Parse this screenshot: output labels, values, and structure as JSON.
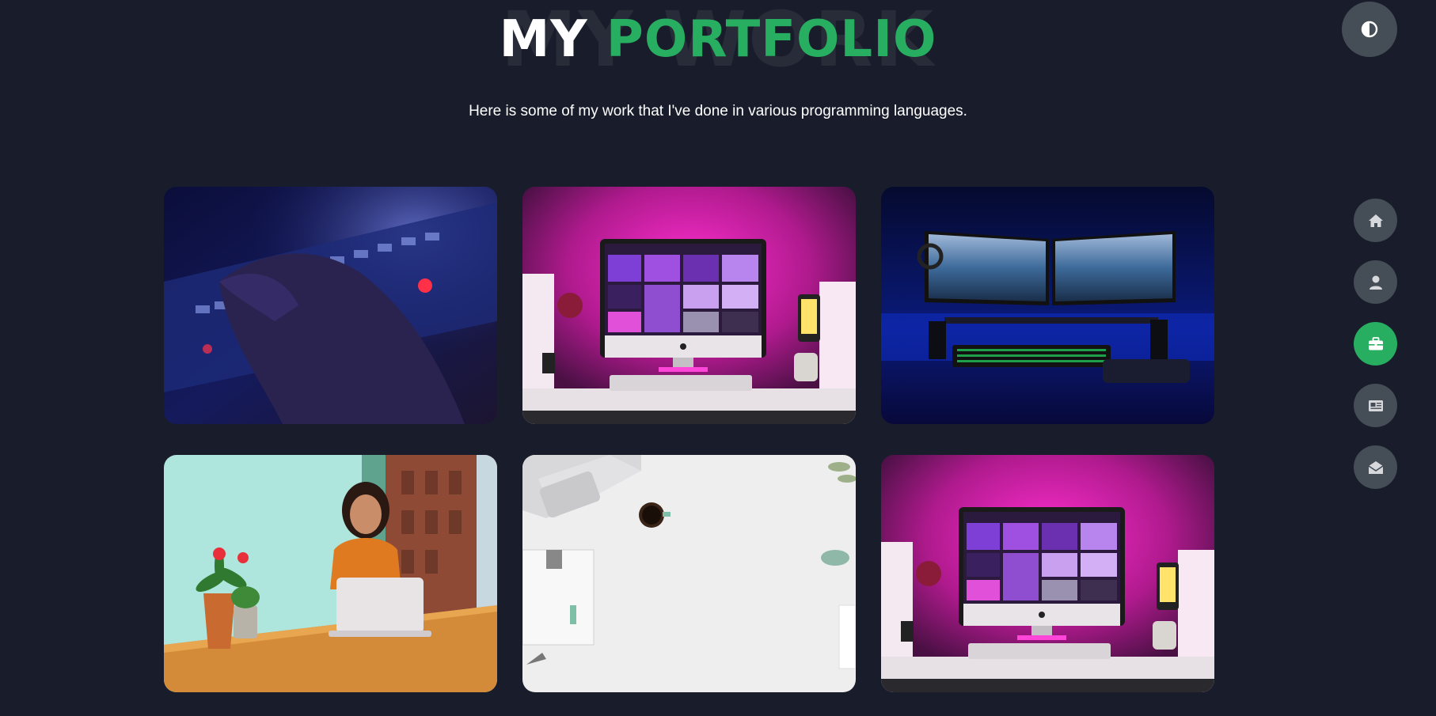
{
  "heading": {
    "background_text": "MY WORK",
    "title_plain": "MY",
    "title_accent": "PORTFOLIO"
  },
  "subtitle": "Here is some of my work that I've done in various programming languages.",
  "colors": {
    "background": "#191d2b",
    "accent": "#27ae60",
    "button": "#454e56",
    "text": "#ffffff"
  },
  "theme_toggle": {
    "icon": "contrast-icon"
  },
  "side_nav": [
    {
      "id": "home",
      "icon": "home-icon",
      "active": false
    },
    {
      "id": "about",
      "icon": "user-icon",
      "active": false
    },
    {
      "id": "portfolio",
      "icon": "briefcase-icon",
      "active": true
    },
    {
      "id": "blogs",
      "icon": "newspaper-icon",
      "active": false
    },
    {
      "id": "contact",
      "icon": "envelope-open-icon",
      "active": false
    }
  ],
  "portfolio_items": [
    {
      "image": "hand-on-keyboard-image"
    },
    {
      "image": "pink-desk-imac-image"
    },
    {
      "image": "dual-monitor-setup-image"
    },
    {
      "image": "woman-with-laptop-image"
    },
    {
      "image": "white-desk-flatlay-image"
    },
    {
      "image": "pink-desk-imac-image"
    }
  ]
}
